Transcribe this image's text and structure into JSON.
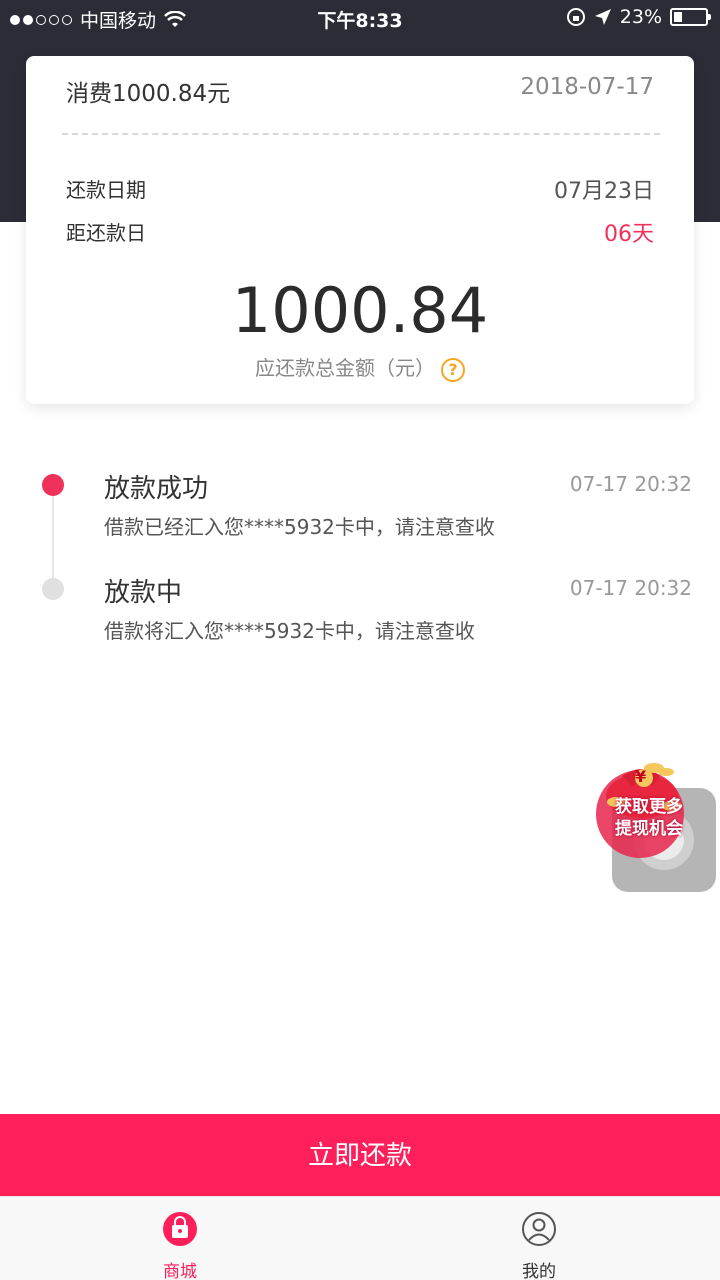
{
  "status_bar": {
    "carrier": "中国移动",
    "time": "下午8:33",
    "battery": "23%"
  },
  "card": {
    "title": "消费1000.84元",
    "date": "2018-07-17",
    "repay_date_label": "还款日期",
    "repay_date_value": "07月23日",
    "days_left_label": "距还款日",
    "days_left_value": "06天",
    "amount": "1000.84",
    "amount_label": "应还款总金额（元）"
  },
  "timeline": [
    {
      "title": "放款成功",
      "time": "07-17 20:32",
      "desc": "借款已经汇入您****5932卡中，请注意查收"
    },
    {
      "title": "放款中",
      "time": "07-17 20:32",
      "desc": "借款将汇入您****5932卡中，请注意查收"
    }
  ],
  "promo": {
    "line1": "获取更多",
    "line2": "提现机会",
    "symbol": "¥"
  },
  "actions": {
    "repay_now": "立即还款"
  },
  "tabbar": {
    "tabs": [
      {
        "label": "商城",
        "icon": "shopping-bag-icon"
      },
      {
        "label": "我的",
        "icon": "user-icon"
      }
    ]
  },
  "colors": {
    "header_bg": "#2b2c36",
    "accent": "#ff1f5a",
    "timeline_active": "#f0315a",
    "timeline_inactive": "#e0e0e0",
    "help": "#f5a623"
  }
}
